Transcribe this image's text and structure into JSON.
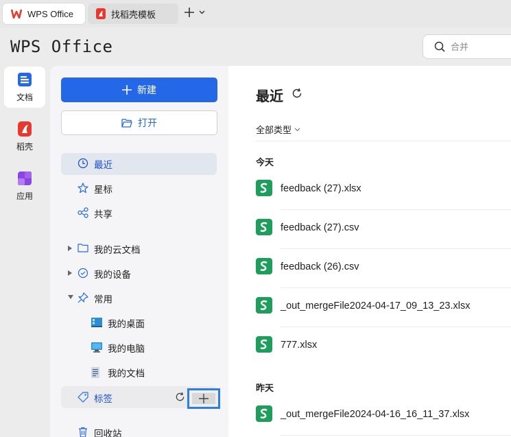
{
  "tabs": [
    {
      "label": "WPS Office",
      "icon": "wps-logo-icon",
      "active": true
    },
    {
      "label": "找稻壳模板",
      "icon": "docer-icon",
      "active": false
    }
  ],
  "header": {
    "app_title": "WPS Office",
    "search_placeholder": "合并"
  },
  "rail": {
    "items": [
      {
        "label": "文档",
        "icon": "document-icon",
        "selected": true
      },
      {
        "label": "稻壳",
        "icon": "docer-icon",
        "selected": false
      },
      {
        "label": "应用",
        "icon": "apps-icon",
        "selected": false
      }
    ]
  },
  "sidebar": {
    "new_label": "新建",
    "open_label": "打开",
    "nav": {
      "recent": "最近",
      "starred": "星标",
      "shared": "共享"
    },
    "tree": {
      "cloud_docs": "我的云文档",
      "my_devices": "我的设备",
      "frequent": "常用",
      "desktop": "我的桌面",
      "computer": "我的电脑",
      "documents": "我的文档",
      "tags": "标签",
      "recycle": "回收站"
    }
  },
  "main": {
    "title": "最近",
    "filter_label": "全部类型",
    "sections": {
      "today": "今天",
      "yesterday": "昨天"
    },
    "files": [
      {
        "name": "feedback (27).xlsx"
      },
      {
        "name": "feedback (27).csv"
      },
      {
        "name": "feedback (26).csv"
      },
      {
        "name": "_out_mergeFile2024-04-17_09_13_23.xlsx"
      },
      {
        "name": "777.xlsx"
      },
      {
        "name": "_out_mergeFile2024-04-16_16_11_37.xlsx"
      }
    ]
  },
  "colors": {
    "accent": "#2468e8",
    "wps_red": "#e8372c",
    "sheet_green": "#1e9e5b",
    "highlight_border": "#2f7de1"
  }
}
